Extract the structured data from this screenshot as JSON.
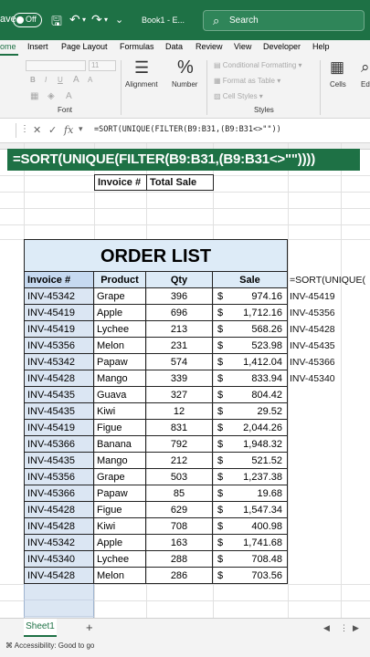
{
  "titlebar": {
    "autosave_label": "ave",
    "toggle_text": "Off",
    "filename": "Book1 - E...",
    "search_placeholder": "Search"
  },
  "ribbon_tabs": [
    "ome",
    "Insert",
    "Page Layout",
    "Formulas",
    "Data",
    "Review",
    "View",
    "Developer",
    "Help"
  ],
  "ribbon": {
    "font_size": "11",
    "font_group_label": "Font",
    "alignment_label": "Alignment",
    "number_label": "Number",
    "percent_glyph": "%",
    "conditional_formatting": "Conditional Formatting",
    "format_as_table": "Format as Table",
    "cell_styles": "Cell Styles",
    "styles_label": "Styles",
    "cells_label": "Cells",
    "edit_label": "Ed",
    "bold": "B",
    "italic": "I",
    "underline": "U",
    "fx": "fx"
  },
  "formula_bar": {
    "formula": "=SORT(UNIQUE(FILTER(B9:B31,(B9:B31<>\"\"))"
  },
  "banner_formula": "=SORT(UNIQUE(FILTER(B9:B31,(B9:B31<>\"\"))))",
  "summary_headers": [
    "Invoice #",
    "Total Sale"
  ],
  "order_list_title": "ORDER LIST",
  "table_headers": [
    "Invoice #",
    "Product",
    "Qty",
    "Sale"
  ],
  "rows": [
    {
      "invoice": "INV-45342",
      "product": "Grape",
      "qty": "396",
      "cur": "$",
      "sale": "974.16"
    },
    {
      "invoice": "INV-45419",
      "product": "Apple",
      "qty": "696",
      "cur": "$",
      "sale": "1,712.16"
    },
    {
      "invoice": "INV-45419",
      "product": "Lychee",
      "qty": "213",
      "cur": "$",
      "sale": "568.26"
    },
    {
      "invoice": "INV-45356",
      "product": "Melon",
      "qty": "231",
      "cur": "$",
      "sale": "523.98"
    },
    {
      "invoice": "INV-45342",
      "product": "Papaw",
      "qty": "574",
      "cur": "$",
      "sale": "1,412.04"
    },
    {
      "invoice": "INV-45428",
      "product": "Mango",
      "qty": "339",
      "cur": "$",
      "sale": "833.94"
    },
    {
      "invoice": "INV-45435",
      "product": "Guava",
      "qty": "327",
      "cur": "$",
      "sale": "804.42"
    },
    {
      "invoice": "INV-45435",
      "product": "Kiwi",
      "qty": "12",
      "cur": "$",
      "sale": "29.52"
    },
    {
      "invoice": "INV-45419",
      "product": "Figue",
      "qty": "831",
      "cur": "$",
      "sale": "2,044.26"
    },
    {
      "invoice": "INV-45366",
      "product": "Banana",
      "qty": "792",
      "cur": "$",
      "sale": "1,948.32"
    },
    {
      "invoice": "INV-45435",
      "product": "Mango",
      "qty": "212",
      "cur": "$",
      "sale": "521.52"
    },
    {
      "invoice": "INV-45356",
      "product": "Grape",
      "qty": "503",
      "cur": "$",
      "sale": "1,237.38"
    },
    {
      "invoice": "INV-45366",
      "product": "Papaw",
      "qty": "85",
      "cur": "$",
      "sale": "19.68"
    },
    {
      "invoice": "INV-45428",
      "product": "Figue",
      "qty": "629",
      "cur": "$",
      "sale": "1,547.34"
    },
    {
      "invoice": "INV-45428",
      "product": "Kiwi",
      "qty": "708",
      "cur": "$",
      "sale": "400.98"
    },
    {
      "invoice": "INV-45342",
      "product": "Apple",
      "qty": "163",
      "cur": "$",
      "sale": "1,741.68"
    },
    {
      "invoice": "INV-45340",
      "product": "Lychee",
      "qty": "288",
      "cur": "$",
      "sale": "708.48"
    },
    {
      "invoice": "INV-45428",
      "product": "Melon",
      "qty": "286",
      "cur": "$",
      "sale": "703.56"
    }
  ],
  "spill_formula": "=SORT(UNIQUE(",
  "spill_values": [
    "INV-45419",
    "INV-45356",
    "INV-45428",
    "INV-45435",
    "INV-45366",
    "INV-45340"
  ],
  "status": {
    "sheet_name": "Sheet1",
    "add_sheet": "+",
    "accessibility": "Accessibility: Good to go"
  },
  "colors": {
    "accent": "#1e7145",
    "header_fill": "#ddebf7",
    "selection": "#dbe6f3"
  }
}
